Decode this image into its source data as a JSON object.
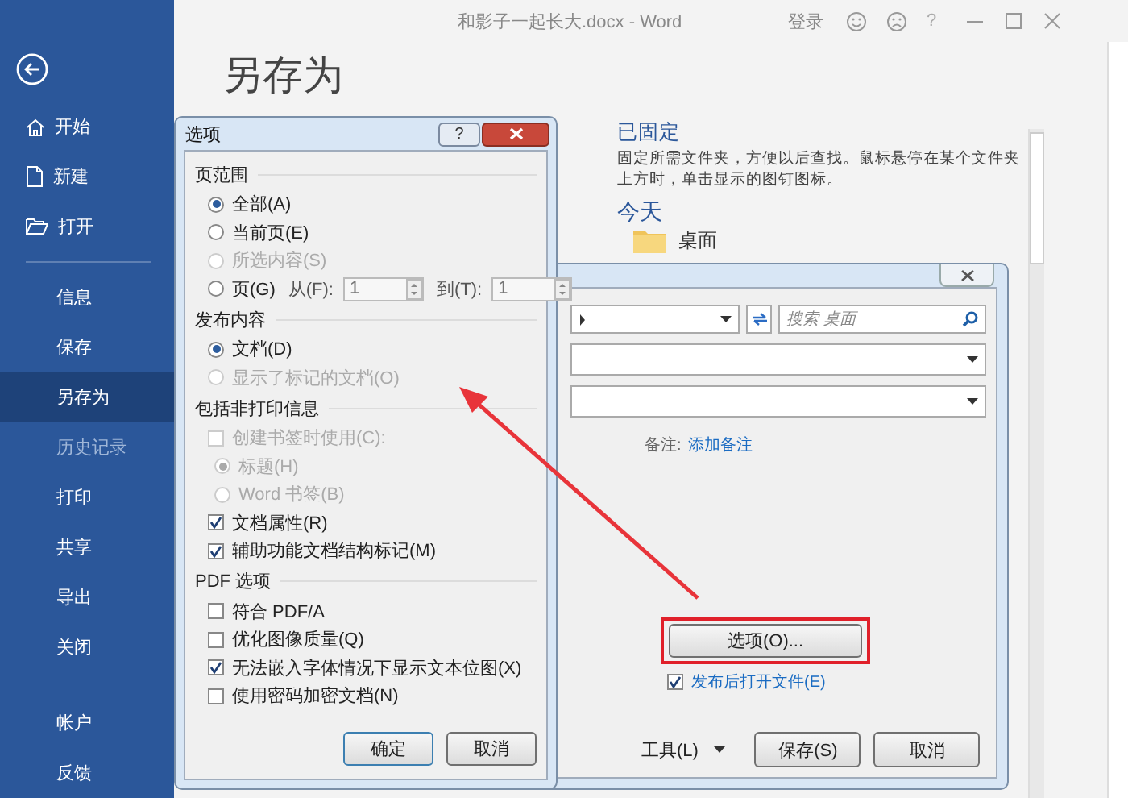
{
  "window": {
    "title": "和影子一起长大.docx - Word",
    "sign_in": "登录",
    "help": "?"
  },
  "sidebar": {
    "items": [
      {
        "label": "开始",
        "kind": "home",
        "selected": false,
        "disabled": false
      },
      {
        "label": "新建",
        "kind": "new",
        "selected": false,
        "disabled": false
      },
      {
        "label": "打开",
        "kind": "open",
        "selected": false,
        "disabled": false
      },
      {
        "label": "信息",
        "kind": "plain",
        "selected": false,
        "disabled": false
      },
      {
        "label": "保存",
        "kind": "plain",
        "selected": false,
        "disabled": false
      },
      {
        "label": "另存为",
        "kind": "plain",
        "selected": true,
        "disabled": false
      },
      {
        "label": "历史记录",
        "kind": "plain",
        "selected": false,
        "disabled": true
      },
      {
        "label": "打印",
        "kind": "plain",
        "selected": false,
        "disabled": false
      },
      {
        "label": "共享",
        "kind": "plain",
        "selected": false,
        "disabled": false
      },
      {
        "label": "导出",
        "kind": "plain",
        "selected": false,
        "disabled": false
      },
      {
        "label": "关闭",
        "kind": "plain",
        "selected": false,
        "disabled": false
      }
    ],
    "footer_items": [
      {
        "label": "帐户",
        "selected": false
      },
      {
        "label": "反馈",
        "selected": false
      }
    ]
  },
  "page": {
    "heading": "另存为",
    "pinned": {
      "title": "已固定",
      "description": "固定所需文件夹，方便以后查找。鼠标悬停在某个文件夹上方时，单击显示的图钉图标。"
    },
    "today": {
      "title": "今天",
      "folders": [
        {
          "name": "桌面"
        }
      ]
    }
  },
  "publish_dialog": {
    "search": {
      "placeholder": "搜索 桌面"
    },
    "notes_label": "备注:",
    "notes_link": "添加备注",
    "options_button": {
      "label": "选项(O)...",
      "highlighted": true
    },
    "open_after": {
      "label": "发布后打开文件(E)",
      "checked": true
    },
    "tools": "工具(L)",
    "buttons": [
      {
        "label": "保存(S)"
      },
      {
        "label": "取消"
      }
    ]
  },
  "options_dialog": {
    "title": "选项",
    "help": "?",
    "sections": [
      {
        "title": "页范围",
        "items": [
          {
            "kind": "radio",
            "label": "全部(A)",
            "selected": true,
            "disabled": false
          },
          {
            "kind": "radio",
            "label": "当前页(E)",
            "selected": false,
            "disabled": false
          },
          {
            "kind": "radio",
            "label": "所选内容(S)",
            "selected": false,
            "disabled": true
          },
          {
            "kind": "range",
            "label": "页(G)",
            "selected": false,
            "disabled": false,
            "from_label": "从(F):",
            "from_value": "1",
            "to_label": "到(T):",
            "to_value": "1"
          }
        ]
      },
      {
        "title": "发布内容",
        "items": [
          {
            "kind": "radio",
            "label": "文档(D)",
            "selected": true,
            "disabled": false
          },
          {
            "kind": "radio",
            "label": "显示了标记的文档(O)",
            "selected": false,
            "disabled": true
          }
        ]
      },
      {
        "title": "包括非打印信息",
        "items": [
          {
            "kind": "checkbox",
            "label": "创建书签时使用(C):",
            "checked": false,
            "disabled": true,
            "children": [
              {
                "kind": "radio",
                "label": "标题(H)",
                "selected": true,
                "disabled": true
              },
              {
                "kind": "radio",
                "label": "Word 书签(B)",
                "selected": false,
                "disabled": true
              }
            ]
          },
          {
            "kind": "checkbox",
            "label": "文档属性(R)",
            "checked": true,
            "disabled": false
          },
          {
            "kind": "checkbox",
            "label": "辅助功能文档结构标记(M)",
            "checked": true,
            "disabled": false
          }
        ]
      },
      {
        "title": "PDF 选项",
        "items": [
          {
            "kind": "checkbox",
            "label": "符合 PDF/A",
            "checked": false,
            "disabled": false
          },
          {
            "kind": "checkbox",
            "label": "优化图像质量(Q)",
            "checked": false,
            "disabled": false
          },
          {
            "kind": "checkbox",
            "label": "无法嵌入字体情况下显示文本位图(X)",
            "checked": true,
            "disabled": false
          },
          {
            "kind": "checkbox",
            "label": "使用密码加密文档(N)",
            "checked": false,
            "disabled": false
          }
        ]
      }
    ],
    "buttons": [
      {
        "label": "确定"
      },
      {
        "label": "取消"
      }
    ]
  }
}
